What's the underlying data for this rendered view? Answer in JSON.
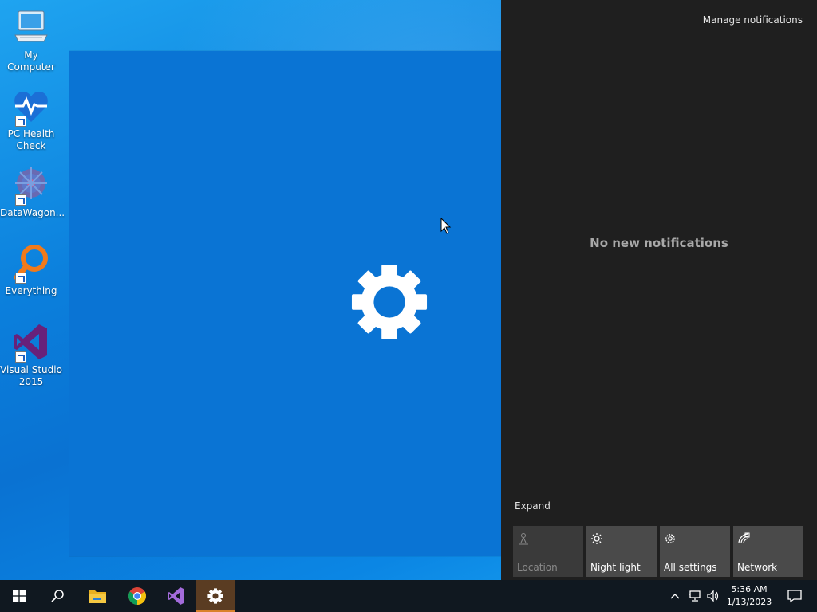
{
  "desktop": {
    "icons": [
      {
        "label": "My Computer"
      },
      {
        "label": "PC Health Check"
      },
      {
        "label": "DataWagon..."
      },
      {
        "label": "Everything"
      },
      {
        "label": "Visual Studio 2015"
      }
    ]
  },
  "action_center": {
    "manage_notifications": "Manage notifications",
    "empty_message": "No new notifications",
    "expand_label": "Expand",
    "quick_actions": [
      {
        "label": "Location",
        "icon": "location-icon",
        "enabled": false
      },
      {
        "label": "Night light",
        "icon": "night-light-icon",
        "enabled": true
      },
      {
        "label": "All settings",
        "icon": "gear-icon",
        "enabled": true
      },
      {
        "label": "Network",
        "icon": "network-icon",
        "enabled": true
      }
    ]
  },
  "taskbar": {
    "apps": [
      "start-icon",
      "search-icon",
      "file-explorer-icon",
      "chrome-icon",
      "visual-studio-icon",
      "settings-icon"
    ],
    "active_app": "settings-icon",
    "clock_time": "5:36 AM",
    "clock_date": "1/13/2023"
  },
  "colors": {
    "action_center_bg": "#1f1f1f",
    "splash_bg": "#0a74d4",
    "taskbar_bg": "#101820",
    "active_accent": "#d9822b"
  }
}
